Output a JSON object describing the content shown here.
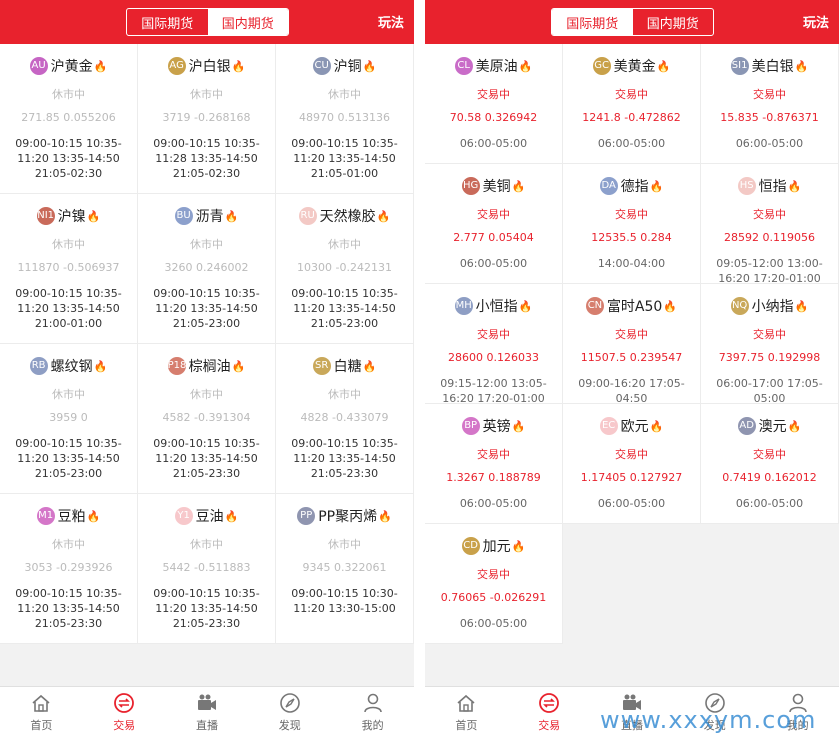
{
  "screens": [
    {
      "header": {
        "tab_international": "国际期货",
        "tab_domestic": "国内期货",
        "active": "domestic",
        "help_label": "玩法"
      },
      "products": [
        {
          "badge": "AU",
          "name": "沪黄金",
          "status": "休市中",
          "quote": "271.85 0.055206",
          "hours": "09:00-10:15 10:35-11:20 13:35-14:50 21:05-02:30",
          "badge_color": "#c665c4"
        },
        {
          "badge": "AG",
          "name": "沪白银",
          "status": "休市中",
          "quote": "3719 -0.268168",
          "hours": "09:00-10:15 10:35-11:28 13:35-14:50 21:05-02:30",
          "badge_color": "#c9a14a"
        },
        {
          "badge": "CU",
          "name": "沪铜",
          "status": "休市中",
          "quote": "48970 0.513136",
          "hours": "09:00-10:15 10:35-11:20 13:35-14:50 21:05-01:00",
          "badge_color": "#8a96b4"
        },
        {
          "badge": "NI1",
          "name": "沪镍",
          "status": "休市中",
          "quote": "111870 -0.506937",
          "hours": "09:00-10:15 10:35-11:20 13:35-14:50 21:00-01:00",
          "badge_color": "#c96a5a"
        },
        {
          "badge": "BU",
          "name": "沥青",
          "status": "休市中",
          "quote": "3260 0.246002",
          "hours": "09:00-10:15 10:35-11:20 13:35-14:50 21:05-23:00",
          "badge_color": "#8ca0cc"
        },
        {
          "badge": "RU",
          "name": "天然橡胶",
          "status": "休市中",
          "quote": "10300 -0.242131",
          "hours": "09:00-10:15 10:35-11:20 13:35-14:50 21:05-23:00",
          "badge_color": "#f3c9c5"
        },
        {
          "badge": "RB",
          "name": "螺纹钢",
          "status": "休市中",
          "quote": "3959 0",
          "hours": "09:00-10:15 10:35-11:20 13:35-14:50 21:05-23:00",
          "badge_color": "#8e9ec4"
        },
        {
          "badge": "P18",
          "name": "棕榈油",
          "status": "休市中",
          "quote": "4582 -0.391304",
          "hours": "09:00-10:15 10:35-11:20 13:35-14:50 21:05-23:30",
          "badge_color": "#d67e6e"
        },
        {
          "badge": "SR",
          "name": "白糖",
          "status": "休市中",
          "quote": "4828 -0.433079",
          "hours": "09:00-10:15 10:35-11:20 13:35-14:50 21:05-23:30",
          "badge_color": "#c9a85a"
        },
        {
          "badge": "M1",
          "name": "豆粕",
          "status": "休市中",
          "quote": "3053 -0.293926",
          "hours": "09:00-10:15 10:35-11:20 13:35-14:50 21:05-23:30",
          "badge_color": "#d476c8"
        },
        {
          "badge": "Y1",
          "name": "豆油",
          "status": "休市中",
          "quote": "5442 -0.511883",
          "hours": "09:00-10:15 10:35-11:20 13:35-14:50 21:05-23:30",
          "badge_color": "#f7c8cb"
        },
        {
          "badge": "PP",
          "name": "PP聚丙烯",
          "status": "休市中",
          "quote": "9345 0.322061",
          "hours": "09:00-10:15 10:30-11:20 13:30-15:00",
          "badge_color": "#8f95b0"
        }
      ],
      "tabbar": [
        {
          "label": "首页",
          "icon": "home-icon"
        },
        {
          "label": "交易",
          "icon": "trade-icon",
          "active": true
        },
        {
          "label": "直播",
          "icon": "video-camera-icon"
        },
        {
          "label": "发现",
          "icon": "compass-icon"
        },
        {
          "label": "我的",
          "icon": "user-icon"
        }
      ]
    },
    {
      "header": {
        "tab_international": "国际期货",
        "tab_domestic": "国内期货",
        "active": "international",
        "help_label": "玩法"
      },
      "products": [
        {
          "badge": "CL",
          "name": "美原油",
          "status": "交易中",
          "quote": "70.58 0.326942",
          "hours": "06:00-05:00",
          "badge_color": "#c96cc8"
        },
        {
          "badge": "GC",
          "name": "美黄金",
          "status": "交易中",
          "quote": "1241.8 -0.472862",
          "hours": "06:00-05:00",
          "badge_color": "#c9a14a"
        },
        {
          "badge": "SI1",
          "name": "美白银",
          "status": "交易中",
          "quote": "15.835 -0.876371",
          "hours": "06:00-05:00",
          "badge_color": "#8a96b4"
        },
        {
          "badge": "HG",
          "name": "美铜",
          "status": "交易中",
          "quote": "2.777 0.05404",
          "hours": "06:00-05:00",
          "badge_color": "#c96a5a"
        },
        {
          "badge": "DA",
          "name": "德指",
          "status": "交易中",
          "quote": "12535.5 0.284",
          "hours": "14:00-04:00",
          "badge_color": "#8ca0cc"
        },
        {
          "badge": "HS",
          "name": "恒指",
          "status": "交易中",
          "quote": "28592 0.119056",
          "hours": "09:05-12:00 13:00-16:20 17:20-01:00",
          "badge_color": "#f3c9c5"
        },
        {
          "badge": "MH",
          "name": "小恒指",
          "status": "交易中",
          "quote": "28600 0.126033",
          "hours": "09:15-12:00 13:05-16:20 17:20-01:00",
          "badge_color": "#8e9ec4"
        },
        {
          "badge": "CN",
          "name": "富时A50",
          "status": "交易中",
          "quote": "11507.5 0.239547",
          "hours": "09:00-16:20 17:05-04:50",
          "badge_color": "#d67e6e"
        },
        {
          "badge": "NQ",
          "name": "小纳指",
          "status": "交易中",
          "quote": "7397.75 0.192998",
          "hours": "06:00-17:00 17:05-05:00",
          "badge_color": "#c9a85a"
        },
        {
          "badge": "BP",
          "name": "英镑",
          "status": "交易中",
          "quote": "1.3267 0.188789",
          "hours": "06:00-05:00",
          "badge_color": "#d476c8"
        },
        {
          "badge": "EC",
          "name": "欧元",
          "status": "交易中",
          "quote": "1.17405 0.127927",
          "hours": "06:00-05:00",
          "badge_color": "#f7c8cb"
        },
        {
          "badge": "AD",
          "name": "澳元",
          "status": "交易中",
          "quote": "0.7419 0.162012",
          "hours": "06:00-05:00",
          "badge_color": "#8f95b0"
        },
        {
          "badge": "CD",
          "name": "加元",
          "status": "交易中",
          "quote": "0.76065 -0.026291",
          "hours": "06:00-05:00",
          "badge_color": "#c9a14a"
        }
      ],
      "tabbar": [
        {
          "label": "首页",
          "icon": "home-icon"
        },
        {
          "label": "交易",
          "icon": "trade-icon",
          "active": true
        },
        {
          "label": "直播",
          "icon": "video-camera-icon"
        },
        {
          "label": "发现",
          "icon": "compass-icon"
        },
        {
          "label": "我的",
          "icon": "user-icon"
        }
      ]
    }
  ],
  "watermark": "www.xxxym.com",
  "colors": {
    "brand_red": "#e8222d",
    "muted_gray": "#bbbbbb"
  }
}
